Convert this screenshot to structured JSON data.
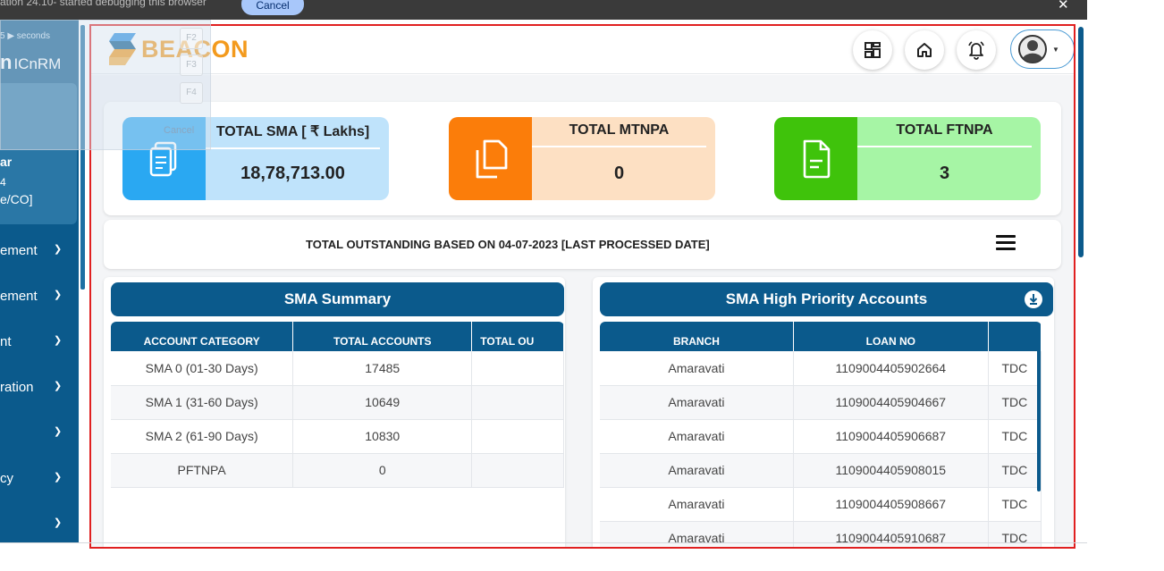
{
  "browser_notice": {
    "text": "ation 24.10- started debugging this browser",
    "cancel_label": "Cancel",
    "close_label": "✕"
  },
  "sidebar": {
    "timer_text": "5 ▶ seconds",
    "brand_prefix": "n",
    "brand_text": "ICnRM",
    "profile": {
      "name": "ar",
      "line2": "4",
      "line3": "e/CO]"
    },
    "menu_items": [
      {
        "label": "ement"
      },
      {
        "label": "ement"
      },
      {
        "label": "nt"
      },
      {
        "label": "ration"
      },
      {
        "label": ""
      },
      {
        "label": "cy"
      },
      {
        "label": ""
      }
    ]
  },
  "overlay": {
    "keys": [
      "F2",
      "F3",
      "F4"
    ],
    "cancel_label": "Cancel"
  },
  "header": {
    "logo_text": "BEACON",
    "icons": [
      "dashboard-icon",
      "home-icon",
      "notification-bell-icon",
      "user-avatar-icon"
    ]
  },
  "stats": [
    {
      "title": "TOTAL SMA [ ₹ Lakhs]",
      "value": "18,78,713.00",
      "icon_bg": "#2aa8f2",
      "body_bg": "#bfe3fb"
    },
    {
      "title": "TOTAL MTNPA",
      "value": "0",
      "icon_bg": "#fb7d0a",
      "body_bg": "#fde0c3"
    },
    {
      "title": "TOTAL FTNPA",
      "value": "3",
      "icon_bg": "#3fc30b",
      "body_bg": "#a6f5a5"
    }
  ],
  "outstanding_text": "TOTAL OUTSTANDING BASED ON 04-07-2023 [LAST PROCESSED DATE]",
  "sma_summary": {
    "title": "SMA Summary",
    "columns": [
      "ACCOUNT CATEGORY",
      "TOTAL ACCOUNTS",
      "TOTAL OU"
    ],
    "rows": [
      [
        "SMA 0 (01-30 Days)",
        "17485",
        ""
      ],
      [
        "SMA 1 (31-60 Days)",
        "10649",
        ""
      ],
      [
        "SMA 2 (61-90 Days)",
        "10830",
        ""
      ],
      [
        "PFTNPA",
        "0",
        ""
      ]
    ]
  },
  "high_priority": {
    "title": "SMA High Priority Accounts",
    "columns": [
      "BRANCH",
      "LOAN NO",
      ""
    ],
    "rows": [
      [
        "Amaravati",
        "1109004405902664",
        "TDC"
      ],
      [
        "Amaravati",
        "1109004405904667",
        "TDC"
      ],
      [
        "Amaravati",
        "1109004405906687",
        "TDC"
      ],
      [
        "Amaravati",
        "1109004405908015",
        "TDC"
      ],
      [
        "Amaravati",
        "1109004405908667",
        "TDC"
      ],
      [
        "Amaravati",
        "1109004405910687",
        "TDC"
      ]
    ]
  },
  "colors": {
    "primary": "#0b5a8c",
    "brand_orange": "#f39a1d",
    "highlight_border": "#e02020"
  }
}
